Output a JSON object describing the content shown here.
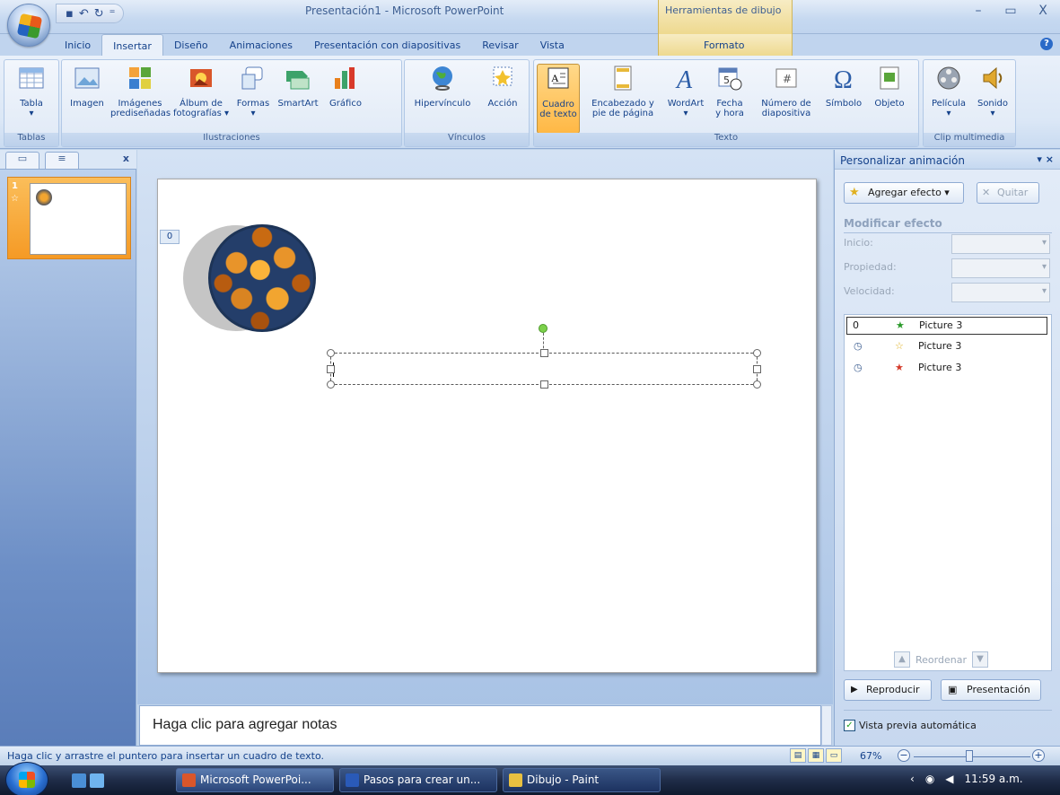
{
  "titlebar": {
    "title": "Presentación1 - Microsoft PowerPoint",
    "context_group": "Herramientas de dibujo",
    "min": "–",
    "max": "▭",
    "close": "X"
  },
  "tabs": [
    "Inicio",
    "Insertar",
    "Diseño",
    "Animaciones",
    "Presentación con diapositivas",
    "Revisar",
    "Vista"
  ],
  "context_tab": "Formato",
  "ribbon": {
    "groups": {
      "tablas": "Tablas",
      "ilustraciones": "Ilustraciones",
      "vinculos": "Vínculos",
      "texto": "Texto",
      "clip": "Clip multimedia"
    },
    "buttons": {
      "tabla": "Tabla",
      "imagen": "Imagen",
      "imagenes_1": "Imágenes",
      "imagenes_2": "prediseñadas",
      "album_1": "Álbum de",
      "album_2": "fotografías ▾",
      "formas": "Formas",
      "smartart": "SmartArt",
      "grafico": "Gráfico",
      "hipervinculo": "Hipervínculo",
      "accion": "Acción",
      "cuadro_1": "Cuadro",
      "cuadro_2": "de texto",
      "encabezado_1": "Encabezado y",
      "encabezado_2": "pie de página",
      "wordart": "WordArt",
      "fecha_1": "Fecha",
      "fecha_2": "y hora",
      "numero_1": "Número de",
      "numero_2": "diapositiva",
      "simbolo": "Símbolo",
      "objeto": "Objeto",
      "pelicula": "Película",
      "sonido": "Sonido"
    }
  },
  "slides_panel": {
    "slide_number": "1"
  },
  "slide": {
    "anim_tag": "0"
  },
  "notes": {
    "placeholder": "Haga clic para agregar notas"
  },
  "task_pane": {
    "title": "Personalizar animación",
    "add_effect": "Agregar efecto ▾",
    "remove": "Quitar",
    "modify_section": "Modificar efecto",
    "inicio_label": "Inicio:",
    "propiedad_label": "Propiedad:",
    "velocidad_label": "Velocidad:",
    "items": [
      {
        "marker": "0",
        "name": "Picture 3"
      },
      {
        "marker": "",
        "name": "Picture 3"
      },
      {
        "marker": "",
        "name": "Picture 3"
      }
    ],
    "reorder": "Reordenar",
    "play": "Reproducir",
    "slideshow": "Presentación",
    "autopreview": "Vista previa automática"
  },
  "statusbar": {
    "hint": "Haga clic y arrastre el puntero para insertar un cuadro de texto.",
    "zoom": "67%"
  },
  "taskbar": {
    "items": [
      "Microsoft PowerPoi...",
      "Pasos para crear un...",
      "Dibujo - Paint"
    ],
    "clock": "11:59 a.m."
  }
}
